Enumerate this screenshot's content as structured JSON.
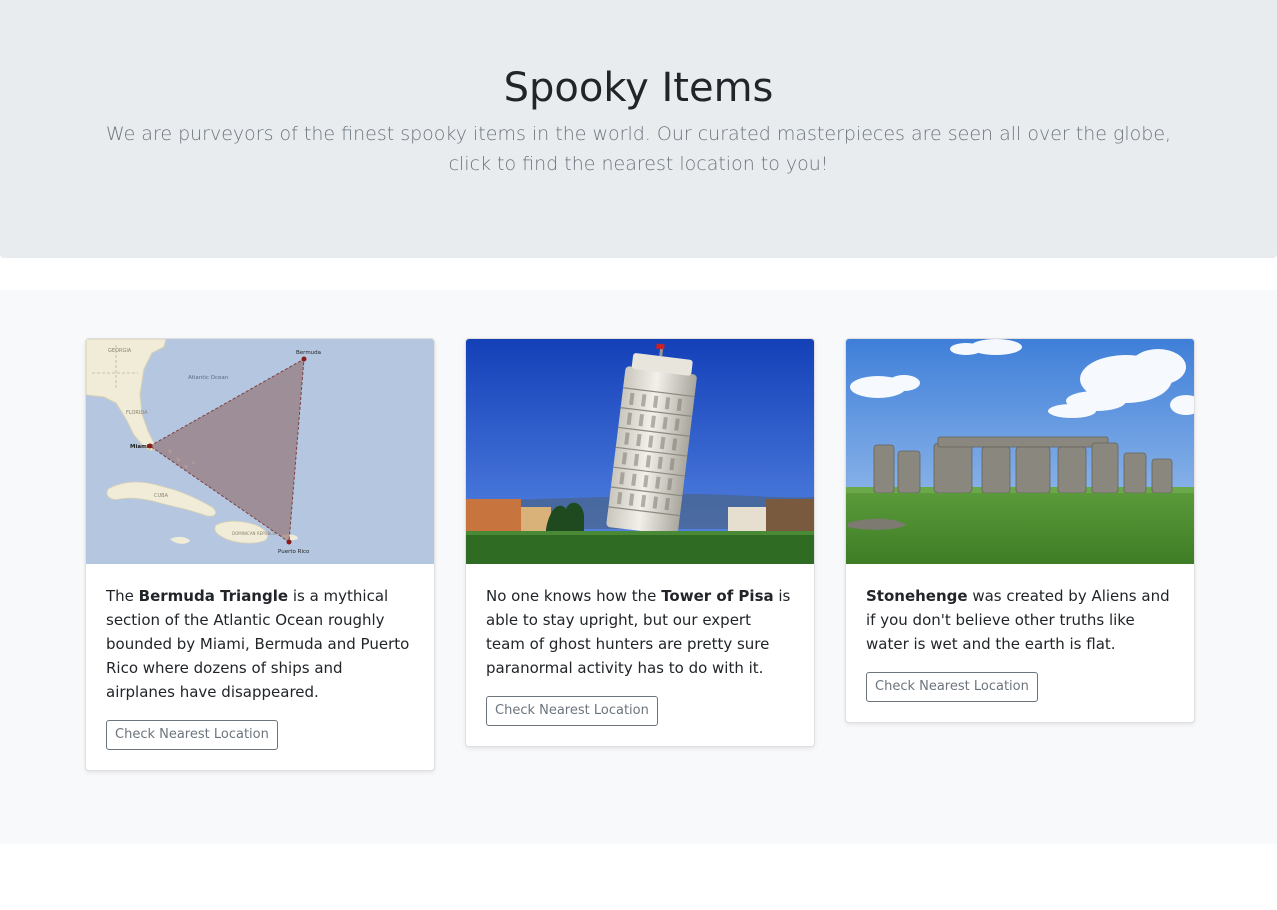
{
  "hero": {
    "title": "Spooky Items",
    "lead": "We are purveyors of the finest spooky items in the world. Our curated masterpieces are seen all over the globe, click to find the nearest location to you!"
  },
  "cards": [
    {
      "text_before": "The ",
      "text_bold": "Bermuda Triangle",
      "text_after": " is a mythical section of the Atlantic Ocean roughly bounded by Miami, Bermuda and Puerto Rico where dozens of ships and airplanes have disappeared.",
      "button_label": "Check Nearest Location",
      "map_labels": {
        "georgia": "GEORGIA",
        "atlantic": "Atlantic Ocean",
        "florida": "FLORIDA",
        "miami": "Miami",
        "bermuda": "Bermuda",
        "puerto_rico": "Puerto Rico",
        "cuba": "CUBA",
        "dominican": "DOMINICAN REPUBLIC"
      }
    },
    {
      "text_before": "No one knows how the ",
      "text_bold": "Tower of Pisa",
      "text_after": " is able to stay upright, but our expert team of ghost hunters are pretty sure paranormal activity has to do with it.",
      "button_label": "Check Nearest Location"
    },
    {
      "text_before": "",
      "text_bold": "Stonehenge",
      "text_after": " was created by Aliens and if you don't believe other truths like water is wet and the earth is flat.",
      "button_label": "Check Nearest Location"
    }
  ],
  "colors": {
    "hero_bg": "#e9ecef",
    "album_bg": "#f8f9fa",
    "muted_text": "#6c757d",
    "sea": "#b5c7e0",
    "sky": "#1f52c9",
    "grass": "#3d8a2e"
  }
}
